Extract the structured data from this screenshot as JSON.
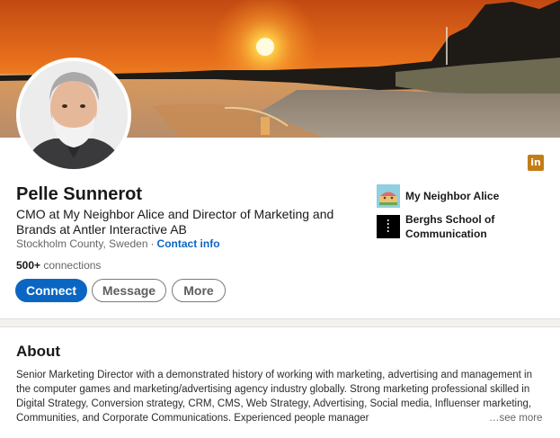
{
  "profile": {
    "name": "Pelle Sunnerot",
    "headline": "CMO at My Neighbor Alice and Director of Marketing and Brands at Antler Interactive AB",
    "location": "Stockholm County, Sweden",
    "separator": "·",
    "contact_info": "Contact info",
    "connections_count": "500+",
    "connections_label": "connections"
  },
  "badge": {
    "icon": "linkedin-icon",
    "text": "in",
    "color": "#c37d16"
  },
  "actions": {
    "connect": "Connect",
    "message": "Message",
    "more": "More"
  },
  "organizations": [
    {
      "name": "My Neighbor Alice",
      "icon": "my-neighbor-alice-logo"
    },
    {
      "name": "Berghs School of Communication",
      "icon": "berghs-logo"
    }
  ],
  "about": {
    "title": "About",
    "text": "Senior Marketing Director with a demonstrated history of working with marketing, advertising and management in the computer games and marketing/advertising agency industry globally. Strong marketing professional skilled in Digital Strategy, Conversion strategy, CRM, CMS, Web Strategy, Advertising, Social media, Influenser marketing, Communities, and Corporate Communications. Experienced people manager",
    "see_more": "…see more"
  },
  "colors": {
    "primary": "#0a66c2",
    "text": "#191919",
    "muted": "#666666",
    "background": "#f3f2ef"
  }
}
